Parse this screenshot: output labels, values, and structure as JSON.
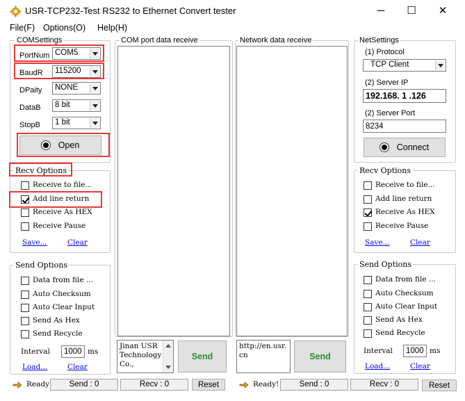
{
  "window": {
    "title": "USR-TCP232-Test  RS232 to Ethernet Convert tester",
    "minimize": "─",
    "maximize": "☐",
    "close": "✕"
  },
  "menu": {
    "file": "File(F)",
    "options": "Options(O)",
    "help": "Help(H)"
  },
  "com_settings": {
    "title": "COMSettings",
    "port_label": "PortNum",
    "port_value": "COM5",
    "baud_label": "BaudR",
    "baud_value": "115200",
    "parity_label": "DPaity",
    "parity_value": "NONE",
    "databits_label": "DataB",
    "databits_value": "8 bit",
    "stopbits_label": "StopB",
    "stopbits_value": "1 bit",
    "open_button": "Open"
  },
  "left_recv": {
    "title": "Recv Options",
    "receive_to_file": "Receive to file...",
    "add_line_return": "Add line return",
    "receive_as_hex": "Receive As HEX",
    "receive_pause": "Receive Pause",
    "save_link": "Save...",
    "clear_link": "Clear"
  },
  "left_send": {
    "title": "Send Options",
    "data_from_file": "Data from file ...",
    "auto_checksum": "Auto Checksum",
    "auto_clear_input": "Auto Clear Input",
    "send_as_hex": "Send As Hex",
    "send_recycle": "Send Recycle",
    "interval_label": "Interval",
    "interval_value": "1000",
    "interval_unit": "ms",
    "load_link": "Load...",
    "clear_link": "Clear"
  },
  "com_pane_title": "COM port data receive",
  "net_pane_title": "Network data receive",
  "com_send": {
    "text": "Jinan USR Technology Co.,",
    "button": "Send"
  },
  "net_send": {
    "text": "http://en.usr.cn",
    "button": "Send"
  },
  "net_settings": {
    "title": "NetSettings",
    "protocol_label": "(1) Protocol",
    "protocol_value": "TCP Client",
    "server_ip_label": "(2) Server IP",
    "server_ip_value": "192.168. 1 .126",
    "server_port_label": "(2) Server Port",
    "server_port_value": "8234",
    "connect_button": "Connect"
  },
  "right_recv": {
    "title": "Recv Options",
    "receive_to_file": "Receive to file...",
    "add_line_return": "Add line return",
    "receive_as_hex": "Receive As HEX",
    "receive_pause": "Receive Pause",
    "save_link": "Save...",
    "clear_link": "Clear"
  },
  "right_send": {
    "title": "Send Options",
    "data_from_file": "Data from file ...",
    "auto_checksum": "Auto Checksum",
    "auto_clear_input": "Auto Clear Input",
    "send_as_hex": "Send As Hex",
    "send_recycle": "Send Recycle",
    "interval_label": "Interval",
    "interval_value": "1000",
    "interval_unit": "ms",
    "load_link": "Load...",
    "clear_link": "Clear"
  },
  "status_left": {
    "ready": "Ready",
    "send": "Send : 0",
    "recv": "Recv : 0",
    "reset": "Reset"
  },
  "status_right": {
    "ready": "Ready!",
    "send": "Send : 0",
    "recv": "Recv : 0",
    "reset": "Reset"
  },
  "colors": {
    "highlight": "#e53935",
    "send_text": "#2e8b2e",
    "link": "#0000ee"
  }
}
